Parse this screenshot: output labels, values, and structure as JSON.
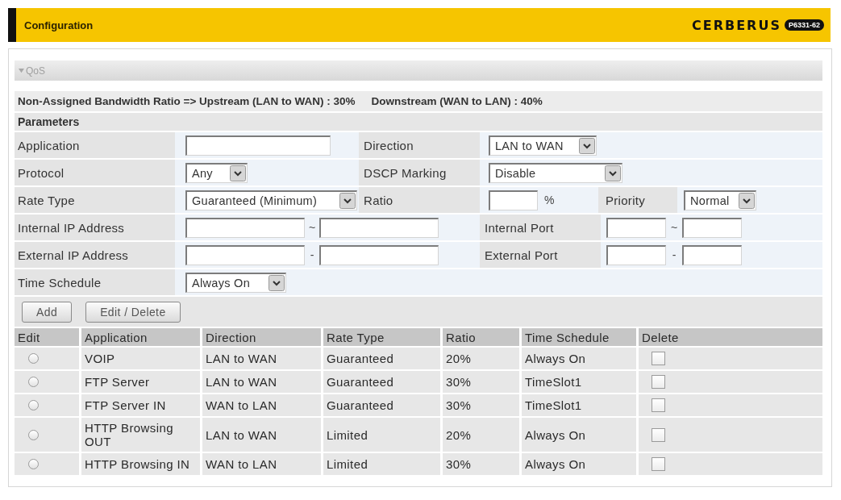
{
  "header": {
    "title": "Configuration",
    "logo": "CERBERUS",
    "model_badge": "P6331-62"
  },
  "section": {
    "title": "QoS",
    "expanded": true
  },
  "bandwidth": {
    "upstream": "Non-Assigned Bandwidth Ratio => Upstream (LAN to WAN) : 30%",
    "downstream": "Downstream (WAN to LAN) : 40%"
  },
  "parameters": {
    "title": "Parameters",
    "rows": [
      [
        {
          "kind": "label",
          "text": "Application"
        },
        {
          "kind": "input"
        },
        {
          "kind": "label",
          "text": "Direction"
        },
        {
          "kind": "select",
          "value": "LAN to WAN"
        }
      ],
      [
        {
          "kind": "label",
          "text": "Protocol"
        },
        {
          "kind": "select",
          "value": "Any"
        },
        {
          "kind": "label",
          "text": "DSCP Marking"
        },
        {
          "kind": "select",
          "value": "Disable"
        }
      ],
      [
        {
          "kind": "label",
          "text": "Rate Type"
        },
        {
          "kind": "select",
          "value": "Guaranteed (Minimum)"
        },
        {
          "kind": "label",
          "text": "Ratio"
        },
        {
          "kind": "input",
          "unit": "%"
        },
        {
          "kind": "label",
          "text": "Priority"
        },
        {
          "kind": "select",
          "value": "Normal"
        }
      ],
      [
        {
          "kind": "label",
          "text": "Internal IP Address"
        },
        {
          "kind": "range",
          "separator": "~"
        },
        {
          "kind": "label",
          "text": "Internal Port"
        },
        {
          "kind": "range",
          "separator": "~"
        }
      ],
      [
        {
          "kind": "label",
          "text": "External IP Address"
        },
        {
          "kind": "range",
          "separator": "-"
        },
        {
          "kind": "label",
          "text": "External Port"
        },
        {
          "kind": "range",
          "separator": "-"
        }
      ],
      [
        {
          "kind": "label",
          "text": "Time Schedule"
        },
        {
          "kind": "select",
          "value": "Always On"
        }
      ]
    ]
  },
  "buttons": [
    "Add",
    "Edit / Delete"
  ],
  "table": {
    "columns": [
      "Edit",
      "Application",
      "Direction",
      "Rate Type",
      "Ratio",
      "Time Schedule",
      "Delete"
    ],
    "rows": [
      {
        "selected": false,
        "application": "VOIP",
        "direction": "LAN to WAN",
        "rate_type": "Guaranteed",
        "ratio": "20%",
        "time_schedule": "Always On",
        "delete_checked": false
      },
      {
        "selected": false,
        "application": "FTP Server",
        "direction": "LAN to WAN",
        "rate_type": "Guaranteed",
        "ratio": "30%",
        "time_schedule": "TimeSlot1",
        "delete_checked": false
      },
      {
        "selected": false,
        "application": "FTP Server IN",
        "direction": "WAN to LAN",
        "rate_type": "Guaranteed",
        "ratio": "30%",
        "time_schedule": "TimeSlot1",
        "delete_checked": false
      },
      {
        "selected": false,
        "application": "HTTP Browsing OUT",
        "direction": "LAN to WAN",
        "rate_type": "Limited",
        "ratio": "20%",
        "time_schedule": "Always On",
        "delete_checked": false
      },
      {
        "selected": false,
        "application": "HTTP Browsing IN",
        "direction": "WAN to LAN",
        "rate_type": "Limited",
        "ratio": "30%",
        "time_schedule": "Always On",
        "delete_checked": false
      }
    ]
  }
}
